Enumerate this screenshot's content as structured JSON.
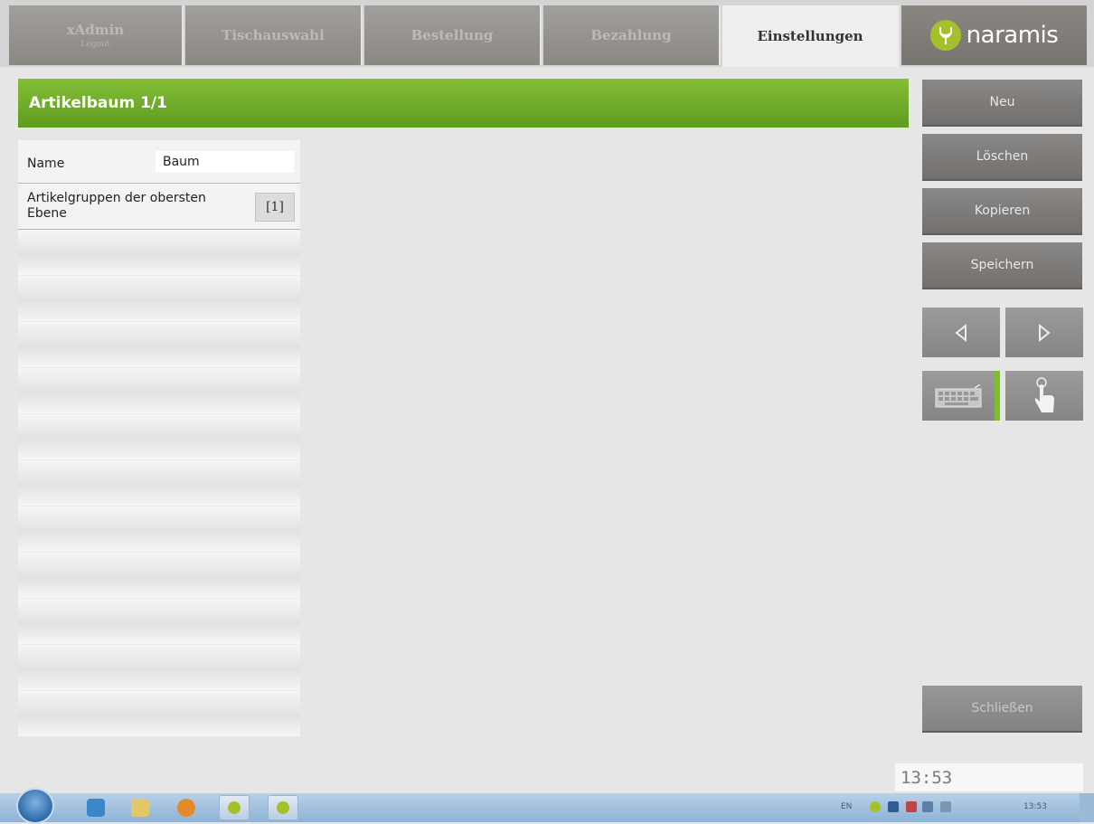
{
  "tabs": [
    {
      "label": "xAdmin",
      "sublabel": "Logout"
    },
    {
      "label": "Tischauswahl"
    },
    {
      "label": "Bestellung"
    },
    {
      "label": "Bezahlung"
    },
    {
      "label": "Einstellungen",
      "active": true
    }
  ],
  "brand": {
    "name": "naramis",
    "color": "#a6c02a"
  },
  "header": {
    "title": "Artikelbaum 1/1",
    "color": "#6aa82a"
  },
  "properties": {
    "name_label": "Name",
    "name_value": "Baum",
    "groups_label": "Artikelgruppen der obersten Ebene",
    "groups_count": "[1]"
  },
  "actions": {
    "new": "Neu",
    "delete": "Löschen",
    "copy": "Kopieren",
    "save": "Speichern",
    "close": "Schließen"
  },
  "icons": {
    "prev": "triangle-left-icon",
    "next": "triangle-right-icon",
    "keyboard": "keyboard-icon",
    "touch": "touch-hand-icon"
  },
  "clock": "13:53",
  "taskbar": {
    "language": "EN",
    "time": "13:53"
  }
}
